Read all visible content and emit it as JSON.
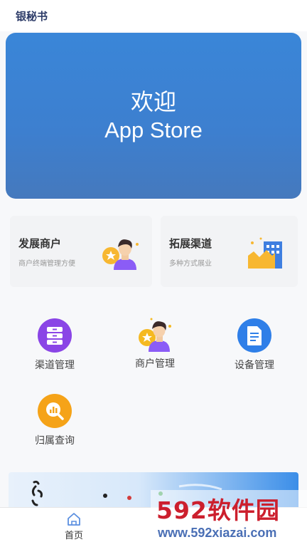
{
  "header": {
    "title": "银秘书"
  },
  "banner": {
    "line1": "欢迎",
    "line2": "App Store"
  },
  "cards": [
    {
      "title": "发展商户",
      "subtitle": "商户终端管理方便",
      "icon": "merchant-avatar-icon"
    },
    {
      "title": "拓展渠道",
      "subtitle": "多种方式展业",
      "icon": "buildings-icon"
    }
  ],
  "grid": [
    {
      "label": "渠道管理",
      "icon": "channel-icon",
      "color": "#8a45e6"
    },
    {
      "label": "商户管理",
      "icon": "merchant-avatar-icon",
      "color": "#f5b922"
    },
    {
      "label": "设备管理",
      "icon": "document-icon",
      "color": "#2f7fe8"
    },
    {
      "label": "归属查询",
      "icon": "search-chart-icon",
      "color": "#f5a318"
    }
  ],
  "tabbar": {
    "home_label": "首页"
  },
  "watermark": {
    "brand": "592软件园",
    "url": "www.592xiazai.com"
  }
}
